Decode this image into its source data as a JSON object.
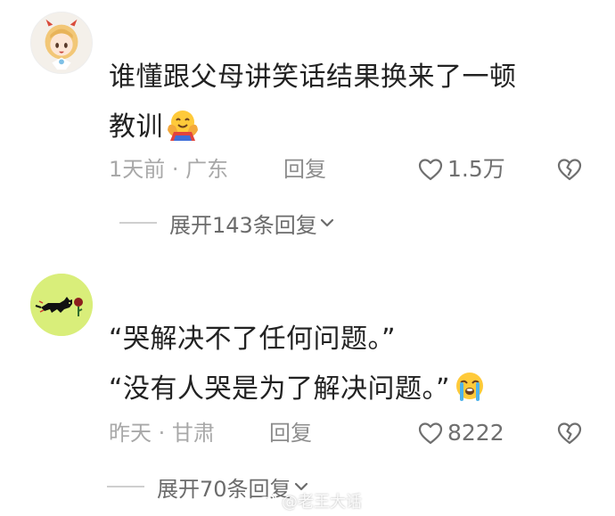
{
  "comments": [
    {
      "text_line1": "谁懂跟父母讲笑话结果换来了一顿",
      "text_line2": "教训",
      "emoji": "hugging-face-emoji",
      "time": "1天前",
      "separator": " · ",
      "location": "广东",
      "reply_label": "回复",
      "likes": "1.5万",
      "expand_label": "展开143条回复"
    },
    {
      "text_line1": "“哭解决不了任何问题。”",
      "text_line2": "“没有人哭是为了解决问题。”",
      "emoji": "loudly-crying-face-emoji",
      "time": "昨天",
      "separator": " · ",
      "location": "甘肃",
      "reply_label": "回复",
      "likes": "8222",
      "expand_label": "展开70条回复"
    }
  ],
  "watermark": "@老王大话",
  "colors": {
    "text": "#222222",
    "meta": "#a8a8a8",
    "icon": "#6f6f6f",
    "avatar2_bg": "#d9ee7a"
  }
}
